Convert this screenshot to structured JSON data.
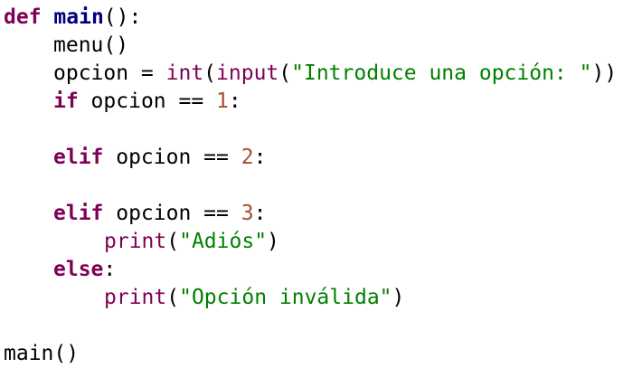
{
  "editor": {
    "lines": [
      {
        "kw_def": "def",
        "fn_name": "main",
        "rest": "():"
      },
      {
        "text": "menu()"
      },
      {
        "var": "opcion = ",
        "int": "int",
        "paren1": "(",
        "input": "input",
        "paren2": "(",
        "str": "\"Introduce una opción: \"",
        "close": "))"
      },
      {
        "kw": "if",
        "cond": " opcion == ",
        "num": "1",
        "colon": ":"
      },
      {
        "blank": ""
      },
      {
        "kw": "elif",
        "cond": " opcion == ",
        "num": "2",
        "colon": ":"
      },
      {
        "blank": ""
      },
      {
        "kw": "elif",
        "cond": " opcion == ",
        "num": "3",
        "colon": ":"
      },
      {
        "print": "print",
        "open": "(",
        "str": "\"Adiós\"",
        "close": ")"
      },
      {
        "kw": "else",
        "colon": ":"
      },
      {
        "print": "print",
        "open": "(",
        "str": "\"Opción inválida\"",
        "close": ")"
      },
      {
        "blank": ""
      },
      {
        "text": "main()"
      }
    ]
  },
  "colors": {
    "keyword": "#7f0055",
    "function_name": "#000080",
    "string": "#008000",
    "number": "#a0522d",
    "background": "#ffffff"
  }
}
